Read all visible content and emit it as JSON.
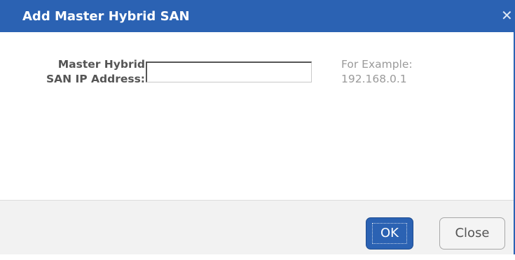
{
  "dialog": {
    "title": "Add Master Hybrid SAN",
    "close_glyph": "✕"
  },
  "form": {
    "label_line1": "Master Hybrid",
    "label_line2": "SAN IP Address:",
    "ip_value": "",
    "example_line1": "For Example:",
    "example_line2": "192.168.0.1"
  },
  "buttons": {
    "ok_label": "OK",
    "close_label": "Close"
  },
  "colors": {
    "accent": "#2b62b3",
    "footer_bg": "#f2f2f2",
    "hint_text": "#9a9a9a",
    "label_text": "#555555"
  }
}
